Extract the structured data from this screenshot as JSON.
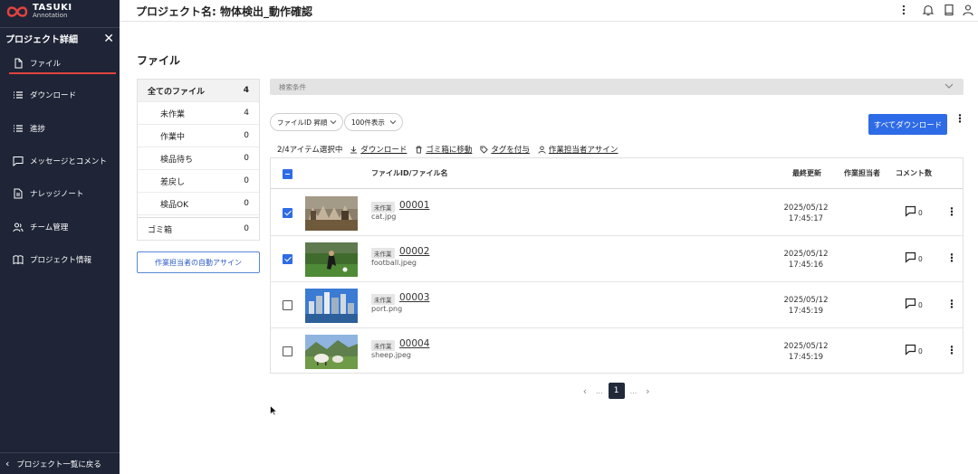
{
  "brand": {
    "name": "TASUKI",
    "sub": "Annotation"
  },
  "sidebar": {
    "title": "プロジェクト詳細",
    "items": [
      {
        "label": "ファイル",
        "icon": "file-icon",
        "active": true
      },
      {
        "label": "ダウンロード",
        "icon": "list-icon"
      },
      {
        "label": "進捗",
        "icon": "progress-list-icon"
      },
      {
        "label": "メッセージとコメント",
        "icon": "message-icon"
      },
      {
        "label": "ナレッジノート",
        "icon": "document-icon"
      },
      {
        "label": "チーム管理",
        "icon": "team-icon"
      },
      {
        "label": "プロジェクト情報",
        "icon": "book-icon"
      }
    ],
    "back_label": "プロジェクト一覧に戻る"
  },
  "header": {
    "title": "プロジェクト名: 物体検出_動作確認"
  },
  "section_title": "ファイル",
  "status_panel": {
    "all": {
      "label": "全てのファイル",
      "count": "4"
    },
    "sub": [
      {
        "label": "未作業",
        "count": "4"
      },
      {
        "label": "作業中",
        "count": "0"
      },
      {
        "label": "検品待ち",
        "count": "0"
      },
      {
        "label": "差戻し",
        "count": "0"
      },
      {
        "label": "検品OK",
        "count": "0"
      }
    ],
    "trash": {
      "label": "ゴミ箱",
      "count": "0"
    },
    "auto_assign": "作業担当者の自動アサイン"
  },
  "search": {
    "label": "検索条件"
  },
  "toolbar": {
    "sort": "ファイルID 昇順",
    "per_page": "100件表示",
    "download_all": "すべてダウンロード"
  },
  "actions": {
    "selected": "2/4アイテム選択中",
    "download": "ダウンロード",
    "trash": "ゴミ箱に移動",
    "tag": "タグを付与",
    "assign": "作業担当者アサイン"
  },
  "table": {
    "headers": {
      "file": "ファイルID/ファイル名",
      "updated": "最終更新",
      "assignee": "作業担当者",
      "comments": "コメント数"
    },
    "rows": [
      {
        "status": "未作業",
        "id": "00001",
        "name": "cat.jpg",
        "date": "2025/05/12",
        "time": "17:45:17",
        "comments": "0",
        "checked": true
      },
      {
        "status": "未作業",
        "id": "00002",
        "name": "football.jpeg",
        "date": "2025/05/12",
        "time": "17:45:16",
        "comments": "0",
        "checked": true
      },
      {
        "status": "未作業",
        "id": "00003",
        "name": "port.png",
        "date": "2025/05/12",
        "time": "17:45:19",
        "comments": "0",
        "checked": false
      },
      {
        "status": "未作業",
        "id": "00004",
        "name": "sheep.jpeg",
        "date": "2025/05/12",
        "time": "17:45:19",
        "comments": "0",
        "checked": false
      }
    ]
  },
  "pager": {
    "current": "1",
    "dots": "..."
  },
  "colors": {
    "sidebar": "#1f2537",
    "accent": "#2e6be6",
    "active_underline": "#e0433f"
  }
}
